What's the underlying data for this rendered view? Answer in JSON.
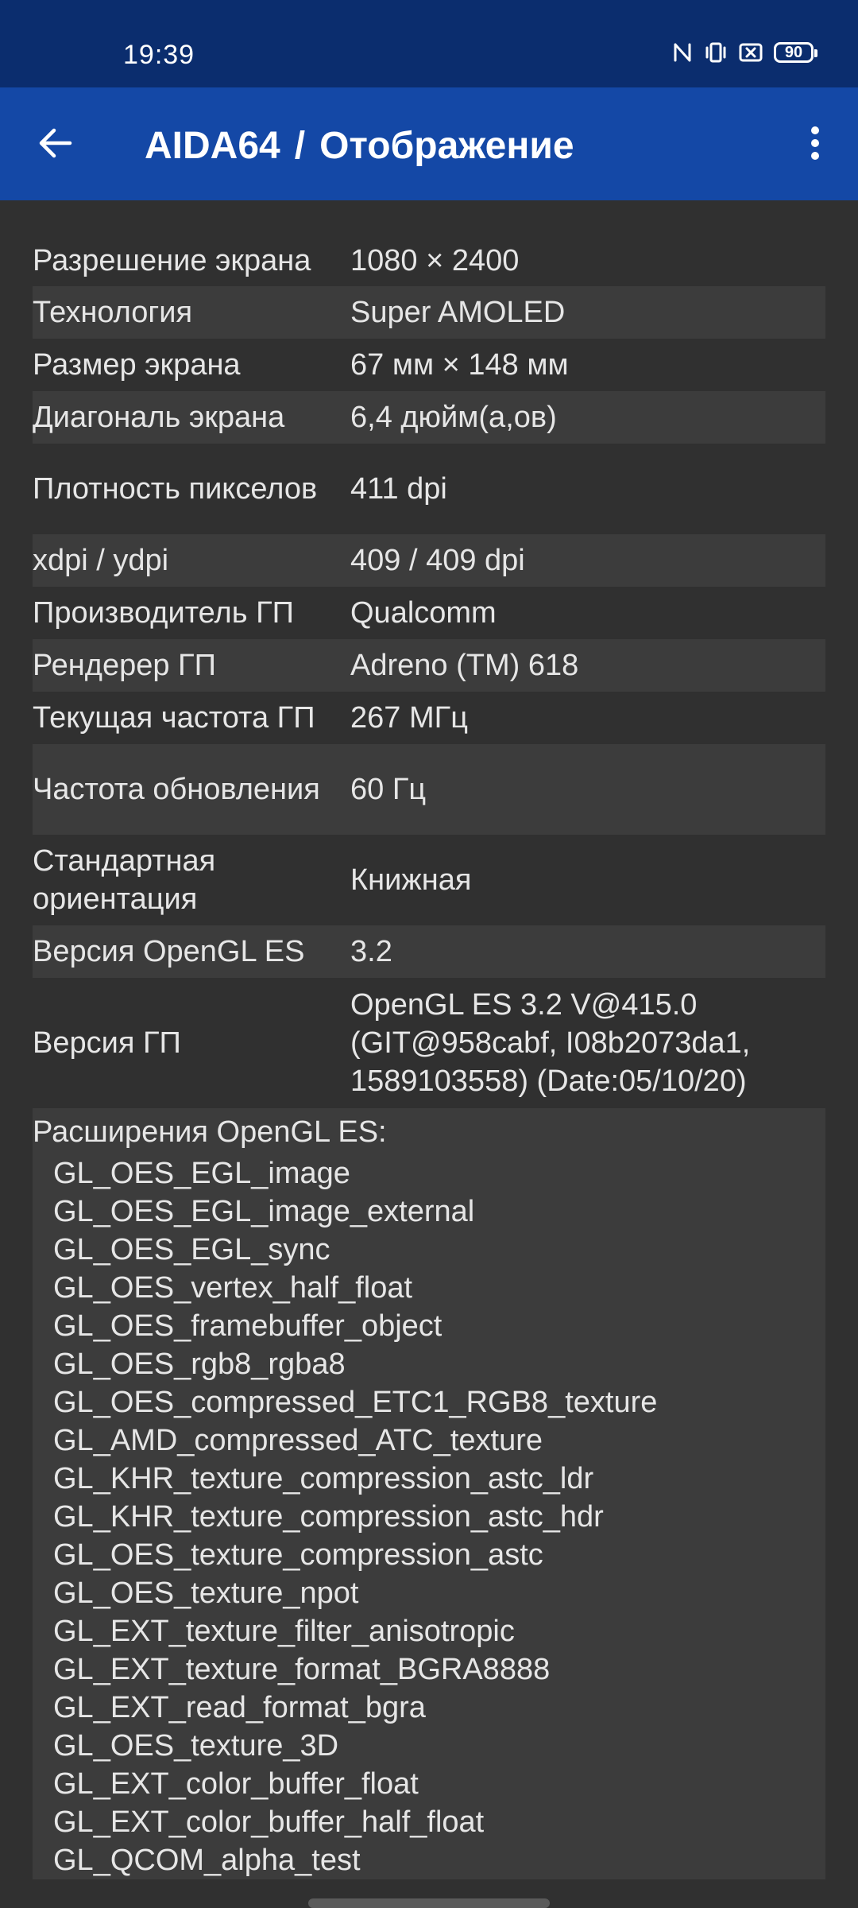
{
  "status_bar": {
    "time": "19:39",
    "battery": "90",
    "icons": [
      "nfc-icon",
      "vibrate-icon",
      "screen-record-icon",
      "battery-icon"
    ]
  },
  "app_bar": {
    "app_name": "AIDA64",
    "separator": "/",
    "page_title": "Отображение",
    "icons": [
      "back-arrow-icon",
      "more-vert-icon"
    ]
  },
  "rows": [
    {
      "label": "Разрешение экрана",
      "value": "1080 × 2400"
    },
    {
      "label": "Технология",
      "value": "Super AMOLED"
    },
    {
      "label": "Размер экрана",
      "value": "67 мм × 148 мм"
    },
    {
      "label": "Диагональ экрана",
      "value": "6,4 дюйм(а,ов)"
    },
    {
      "label": "Плотность пикселов",
      "value": "411 dpi"
    },
    {
      "label": "xdpi / ydpi",
      "value": "409 / 409 dpi"
    },
    {
      "label": "Производитель ГП",
      "value": "Qualcomm"
    },
    {
      "label": "Рендерер ГП",
      "value": "Adreno (TM) 618"
    },
    {
      "label": "Текущая частота ГП",
      "value": "267 МГц"
    },
    {
      "label": "Частота обновления",
      "value": "60 Гц"
    },
    {
      "label": "Стандартная ориентация",
      "value": "Книжная"
    },
    {
      "label": "Версия OpenGL ES",
      "value": "3.2"
    },
    {
      "label": "Версия ГП",
      "value": "OpenGL ES 3.2 V@415.0 (GIT@958cabf, I08b2073da1, 1589103558) (Date:05/10/20)"
    }
  ],
  "extensions": {
    "title": "Расширения OpenGL ES:",
    "items": [
      "GL_OES_EGL_image",
      "GL_OES_EGL_image_external",
      "GL_OES_EGL_sync",
      "GL_OES_vertex_half_float",
      "GL_OES_framebuffer_object",
      "GL_OES_rgb8_rgba8",
      "GL_OES_compressed_ETC1_RGB8_texture",
      "GL_AMD_compressed_ATC_texture",
      "GL_KHR_texture_compression_astc_ldr",
      "GL_KHR_texture_compression_astc_hdr",
      "GL_OES_texture_compression_astc",
      "GL_OES_texture_npot",
      "GL_EXT_texture_filter_anisotropic",
      "GL_EXT_texture_format_BGRA8888",
      "GL_EXT_read_format_bgra",
      "GL_OES_texture_3D",
      "GL_EXT_color_buffer_float",
      "GL_EXT_color_buffer_half_float",
      "GL_QCOM_alpha_test"
    ]
  },
  "colors": {
    "status_bar": "#0b2d6e",
    "app_bar": "#1448a6",
    "background": "#303030",
    "row_alt": "#3c3c3c",
    "text": "#e6e6e6"
  }
}
